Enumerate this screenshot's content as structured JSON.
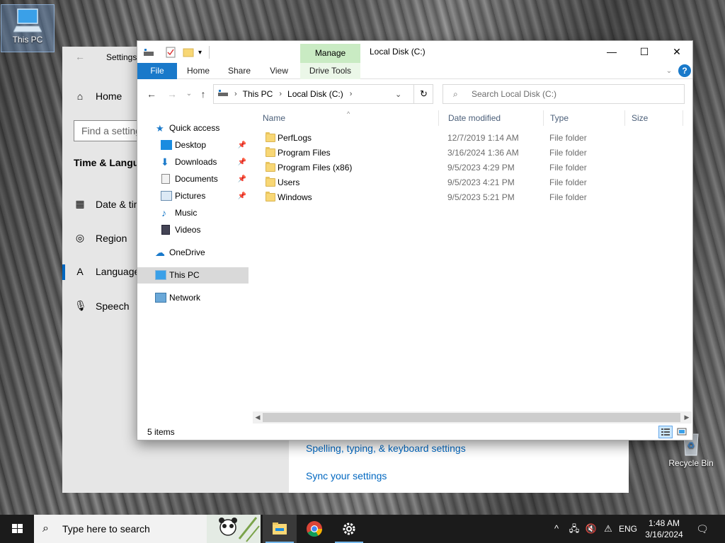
{
  "desktop": {
    "this_pc_label": "This PC",
    "recycle_bin_label": "Recycle Bin"
  },
  "settings": {
    "title": "Settings",
    "nav_home": "Home",
    "find_placeholder": "Find a setting",
    "section_heading": "Time & Language",
    "nav_items": [
      "Date & time",
      "Region",
      "Language",
      "Speech"
    ],
    "links": [
      "Spelling, typing, & keyboard settings",
      "Sync your settings"
    ]
  },
  "explorer": {
    "title": "Local Disk (C:)",
    "context_tab": "Manage",
    "ribbon_tabs": [
      "File",
      "Home",
      "Share",
      "View",
      "Drive Tools"
    ],
    "breadcrumb": [
      "This PC",
      "Local Disk (C:)"
    ],
    "search_placeholder": "Search Local Disk (C:)",
    "nav": {
      "quick_access": "Quick access",
      "pinned": [
        "Desktop",
        "Downloads",
        "Documents",
        "Pictures"
      ],
      "unpinned": [
        "Music",
        "Videos"
      ],
      "onedrive": "OneDrive",
      "this_pc": "This PC",
      "network": "Network"
    },
    "columns": [
      "Name",
      "Date modified",
      "Type",
      "Size"
    ],
    "files": [
      {
        "name": "PerfLogs",
        "date": "12/7/2019 1:14 AM",
        "type": "File folder"
      },
      {
        "name": "Program Files",
        "date": "3/16/2024 1:36 AM",
        "type": "File folder"
      },
      {
        "name": "Program Files (x86)",
        "date": "9/5/2023 4:29 PM",
        "type": "File folder"
      },
      {
        "name": "Users",
        "date": "9/5/2023 4:21 PM",
        "type": "File folder"
      },
      {
        "name": "Windows",
        "date": "9/5/2023 5:21 PM",
        "type": "File folder"
      }
    ],
    "status": "5 items"
  },
  "taskbar": {
    "search_placeholder": "Type here to search",
    "language": "ENG",
    "time": "1:48 AM",
    "date": "3/16/2024"
  },
  "colors": {
    "accent": "#0067c0",
    "file_tab": "#1979ca",
    "manage_tab": "#c9ebc3",
    "folder": "#f8d775",
    "taskbar": "#1b1b1b"
  }
}
